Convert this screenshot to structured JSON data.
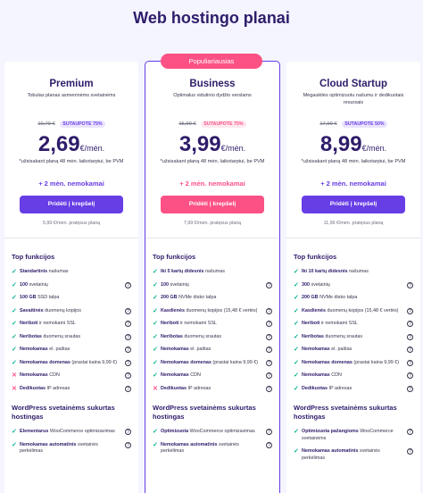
{
  "page": {
    "title": "Web hostingo planai"
  },
  "popular_badge": "Populiariausias",
  "plans": [
    {
      "name": "Premium",
      "description": "Tobulas planas asmeninėms svetainėms",
      "old_price": "10,79 €",
      "discount": "SUTAUPOTE 75%",
      "price": "2,69",
      "per": "€/mėn.",
      "price_note": "*užsisakant planą 48 mėn. laikotarpiui, be PVM",
      "bonus": "+ 2 mėn. nemokamai",
      "cta": "Pridėti į krepšelį",
      "renew": "5,99 €/mėn. pratęsus planą",
      "features_title": "Top funkcijos",
      "features": [
        {
          "bold": "Standartinis",
          "rest": " našumas",
          "included": true,
          "help": false
        },
        {
          "bold": "100",
          "rest": " svetainių",
          "included": true,
          "help": true
        },
        {
          "bold": "100 GB",
          "rest": " SSD talpa",
          "included": true,
          "help": false
        },
        {
          "bold": "Savaitinės",
          "rest": " duomenų kopijos",
          "included": true,
          "help": true
        },
        {
          "bold": "Neriboti",
          "rest": " ir nemokami SSL",
          "included": true,
          "help": true
        },
        {
          "bold": "Neribotas",
          "rest": " duomenų srautas",
          "included": true,
          "help": true
        },
        {
          "bold": "Nemokamas",
          "rest": " el. paštas",
          "included": true,
          "help": true
        },
        {
          "bold": "Nemokamas domenas",
          "rest": " (prastai kaina 9,99 €)",
          "included": true,
          "help": true
        },
        {
          "bold": "Nemokamas",
          "rest": " CDN",
          "included": false,
          "help": true
        },
        {
          "bold": "Dedikuotas",
          "rest": " IP adresas",
          "included": false,
          "help": true
        }
      ],
      "wp_title": "WordPress svetainėms sukurtas hostingas",
      "wp_features": [
        {
          "bold": "Elementarus",
          "rest": " WooCommerce optimizavimas",
          "included": true,
          "help": true
        },
        {
          "bold": "Nemokamas automatinis",
          "rest": " svetainės perkėlimas",
          "included": true,
          "help": true
        }
      ]
    },
    {
      "name": "Business",
      "description": "Optimalus vidutinio dydžio verslams",
      "old_price": "15,99 €",
      "discount": "SUTAUPOTE 75%",
      "price": "3,99",
      "per": "€/mėn.",
      "price_note": "*užsisakant planą 48 mėn. laikotarpiui, be PVM",
      "bonus": "+ 2 mėn. nemokamai",
      "cta": "Pridėti į krepšelį",
      "renew": "7,99 €/mėn. pratęsus planą",
      "features_title": "Top funkcijos",
      "features": [
        {
          "bold": "Iki 5 kartų didesnis",
          "rest": " našumas",
          "included": true,
          "help": false
        },
        {
          "bold": "100",
          "rest": " svetainių",
          "included": true,
          "help": true
        },
        {
          "bold": "200 GB",
          "rest": " NVMe disko talpa",
          "included": true,
          "help": false
        },
        {
          "bold": "Kasdienės",
          "rest": " duomenų kopijos (15,48 € vertės)",
          "included": true,
          "help": true
        },
        {
          "bold": "Neriboti",
          "rest": " ir nemokami SSL",
          "included": true,
          "help": true
        },
        {
          "bold": "Neribotas",
          "rest": " duomenų srautas",
          "included": true,
          "help": true
        },
        {
          "bold": "Nemokamas",
          "rest": " el. paštas",
          "included": true,
          "help": true
        },
        {
          "bold": "Nemokamas domenas",
          "rest": " (prastai kaina 9,99 €)",
          "included": true,
          "help": true
        },
        {
          "bold": "Nemokamas",
          "rest": " CDN",
          "included": true,
          "help": true
        },
        {
          "bold": "Dedikuotas",
          "rest": " IP adresas",
          "included": false,
          "help": true
        }
      ],
      "wp_title": "WordPress svetainėms sukurtas hostingas",
      "wp_features": [
        {
          "bold": "Optimizuota",
          "rest": " WooCommerce optimizavimas",
          "included": true,
          "help": true
        },
        {
          "bold": "Nemokamas automatinis",
          "rest": " svetainės perkėlimas",
          "included": true,
          "help": true
        }
      ]
    },
    {
      "name": "Cloud Startup",
      "description": "Mėgaukitės optimizuotu našumu ir dedikuotais resursais",
      "old_price": "17,99 €",
      "discount": "SUTAUPOTE 50%",
      "price": "8,99",
      "per": "€/mėn.",
      "price_note": "*užsisakant planą 48 mėn. laikotarpiui, be PVM",
      "bonus": "+ 2 mėn. nemokamai",
      "cta": "Pridėti į krepšelį",
      "renew": "11,99 €/mėn. pratęsus planą",
      "features_title": "Top funkcijos",
      "features": [
        {
          "bold": "Iki 10 kartų didesnis",
          "rest": " našumas",
          "included": true,
          "help": false
        },
        {
          "bold": "300",
          "rest": " svetainių",
          "included": true,
          "help": true
        },
        {
          "bold": "200 GB",
          "rest": " NVMe disko talpa",
          "included": true,
          "help": false
        },
        {
          "bold": "Kasdienės",
          "rest": " duomenų kopijos (15,48 € vertės)",
          "included": true,
          "help": true
        },
        {
          "bold": "Neriboti",
          "rest": " ir nemokami SSL",
          "included": true,
          "help": true
        },
        {
          "bold": "Neribotas",
          "rest": " duomenų srautas",
          "included": true,
          "help": true
        },
        {
          "bold": "Nemokamas",
          "rest": " el. paštas",
          "included": true,
          "help": true
        },
        {
          "bold": "Nemokamas domenas",
          "rest": " (prastai kaina 9,99 €)",
          "included": true,
          "help": true
        },
        {
          "bold": "Nemokamas",
          "rest": " CDN",
          "included": true,
          "help": true
        },
        {
          "bold": "Dedikuotas",
          "rest": " IP adresas",
          "included": true,
          "help": true
        }
      ],
      "wp_title": "WordPress svetainėms sukurtas hostingas",
      "wp_features": [
        {
          "bold": "Optimizuota pažangioms",
          "rest": " WooCommerce svetainėms",
          "included": true,
          "help": true
        },
        {
          "bold": "Nemokamas automatinis",
          "rest": " svetainės perkėlimas",
          "included": true,
          "help": true
        }
      ]
    }
  ],
  "colors": {
    "primary": "#673de6",
    "accent": "#fc5185",
    "check": "#00b090",
    "text": "#2f1c6a",
    "background": "#f4f5ff"
  },
  "icons": {
    "included": "check-icon",
    "excluded": "cross-icon",
    "help": "question-circle-icon"
  }
}
